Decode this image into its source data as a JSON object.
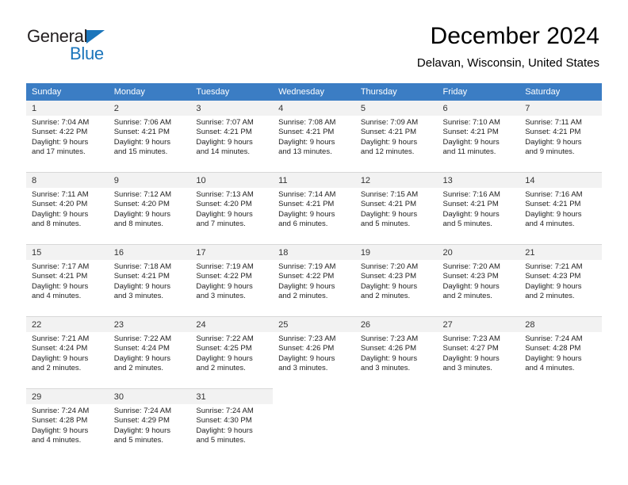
{
  "brand": {
    "word_one": "General",
    "word_two": "Blue",
    "triangle_icon": "triangle-icon",
    "accent_color": "#1b75bb"
  },
  "header": {
    "title": "December 2024",
    "subtitle": "Delavan, Wisconsin, United States"
  },
  "colors": {
    "header_blue": "#3b7dc4",
    "daynum_background": "#f2f2f2",
    "cell_background": "#ffffff",
    "grid_line": "#d8d8d8"
  },
  "weekday_headers": [
    "Sunday",
    "Monday",
    "Tuesday",
    "Wednesday",
    "Thursday",
    "Friday",
    "Saturday"
  ],
  "weeks": [
    {
      "days": [
        {
          "date": "1",
          "sunrise": "Sunrise: 7:04 AM",
          "sunset": "Sunset: 4:22 PM",
          "daylight_line1": "Daylight: 9 hours",
          "daylight_line2": "and 17 minutes."
        },
        {
          "date": "2",
          "sunrise": "Sunrise: 7:06 AM",
          "sunset": "Sunset: 4:21 PM",
          "daylight_line1": "Daylight: 9 hours",
          "daylight_line2": "and 15 minutes."
        },
        {
          "date": "3",
          "sunrise": "Sunrise: 7:07 AM",
          "sunset": "Sunset: 4:21 PM",
          "daylight_line1": "Daylight: 9 hours",
          "daylight_line2": "and 14 minutes."
        },
        {
          "date": "4",
          "sunrise": "Sunrise: 7:08 AM",
          "sunset": "Sunset: 4:21 PM",
          "daylight_line1": "Daylight: 9 hours",
          "daylight_line2": "and 13 minutes."
        },
        {
          "date": "5",
          "sunrise": "Sunrise: 7:09 AM",
          "sunset": "Sunset: 4:21 PM",
          "daylight_line1": "Daylight: 9 hours",
          "daylight_line2": "and 12 minutes."
        },
        {
          "date": "6",
          "sunrise": "Sunrise: 7:10 AM",
          "sunset": "Sunset: 4:21 PM",
          "daylight_line1": "Daylight: 9 hours",
          "daylight_line2": "and 11 minutes."
        },
        {
          "date": "7",
          "sunrise": "Sunrise: 7:11 AM",
          "sunset": "Sunset: 4:21 PM",
          "daylight_line1": "Daylight: 9 hours",
          "daylight_line2": "and 9 minutes."
        }
      ]
    },
    {
      "days": [
        {
          "date": "8",
          "sunrise": "Sunrise: 7:11 AM",
          "sunset": "Sunset: 4:20 PM",
          "daylight_line1": "Daylight: 9 hours",
          "daylight_line2": "and 8 minutes."
        },
        {
          "date": "9",
          "sunrise": "Sunrise: 7:12 AM",
          "sunset": "Sunset: 4:20 PM",
          "daylight_line1": "Daylight: 9 hours",
          "daylight_line2": "and 8 minutes."
        },
        {
          "date": "10",
          "sunrise": "Sunrise: 7:13 AM",
          "sunset": "Sunset: 4:20 PM",
          "daylight_line1": "Daylight: 9 hours",
          "daylight_line2": "and 7 minutes."
        },
        {
          "date": "11",
          "sunrise": "Sunrise: 7:14 AM",
          "sunset": "Sunset: 4:21 PM",
          "daylight_line1": "Daylight: 9 hours",
          "daylight_line2": "and 6 minutes."
        },
        {
          "date": "12",
          "sunrise": "Sunrise: 7:15 AM",
          "sunset": "Sunset: 4:21 PM",
          "daylight_line1": "Daylight: 9 hours",
          "daylight_line2": "and 5 minutes."
        },
        {
          "date": "13",
          "sunrise": "Sunrise: 7:16 AM",
          "sunset": "Sunset: 4:21 PM",
          "daylight_line1": "Daylight: 9 hours",
          "daylight_line2": "and 5 minutes."
        },
        {
          "date": "14",
          "sunrise": "Sunrise: 7:16 AM",
          "sunset": "Sunset: 4:21 PM",
          "daylight_line1": "Daylight: 9 hours",
          "daylight_line2": "and 4 minutes."
        }
      ]
    },
    {
      "days": [
        {
          "date": "15",
          "sunrise": "Sunrise: 7:17 AM",
          "sunset": "Sunset: 4:21 PM",
          "daylight_line1": "Daylight: 9 hours",
          "daylight_line2": "and 4 minutes."
        },
        {
          "date": "16",
          "sunrise": "Sunrise: 7:18 AM",
          "sunset": "Sunset: 4:21 PM",
          "daylight_line1": "Daylight: 9 hours",
          "daylight_line2": "and 3 minutes."
        },
        {
          "date": "17",
          "sunrise": "Sunrise: 7:19 AM",
          "sunset": "Sunset: 4:22 PM",
          "daylight_line1": "Daylight: 9 hours",
          "daylight_line2": "and 3 minutes."
        },
        {
          "date": "18",
          "sunrise": "Sunrise: 7:19 AM",
          "sunset": "Sunset: 4:22 PM",
          "daylight_line1": "Daylight: 9 hours",
          "daylight_line2": "and 2 minutes."
        },
        {
          "date": "19",
          "sunrise": "Sunrise: 7:20 AM",
          "sunset": "Sunset: 4:23 PM",
          "daylight_line1": "Daylight: 9 hours",
          "daylight_line2": "and 2 minutes."
        },
        {
          "date": "20",
          "sunrise": "Sunrise: 7:20 AM",
          "sunset": "Sunset: 4:23 PM",
          "daylight_line1": "Daylight: 9 hours",
          "daylight_line2": "and 2 minutes."
        },
        {
          "date": "21",
          "sunrise": "Sunrise: 7:21 AM",
          "sunset": "Sunset: 4:23 PM",
          "daylight_line1": "Daylight: 9 hours",
          "daylight_line2": "and 2 minutes."
        }
      ]
    },
    {
      "days": [
        {
          "date": "22",
          "sunrise": "Sunrise: 7:21 AM",
          "sunset": "Sunset: 4:24 PM",
          "daylight_line1": "Daylight: 9 hours",
          "daylight_line2": "and 2 minutes."
        },
        {
          "date": "23",
          "sunrise": "Sunrise: 7:22 AM",
          "sunset": "Sunset: 4:24 PM",
          "daylight_line1": "Daylight: 9 hours",
          "daylight_line2": "and 2 minutes."
        },
        {
          "date": "24",
          "sunrise": "Sunrise: 7:22 AM",
          "sunset": "Sunset: 4:25 PM",
          "daylight_line1": "Daylight: 9 hours",
          "daylight_line2": "and 2 minutes."
        },
        {
          "date": "25",
          "sunrise": "Sunrise: 7:23 AM",
          "sunset": "Sunset: 4:26 PM",
          "daylight_line1": "Daylight: 9 hours",
          "daylight_line2": "and 3 minutes."
        },
        {
          "date": "26",
          "sunrise": "Sunrise: 7:23 AM",
          "sunset": "Sunset: 4:26 PM",
          "daylight_line1": "Daylight: 9 hours",
          "daylight_line2": "and 3 minutes."
        },
        {
          "date": "27",
          "sunrise": "Sunrise: 7:23 AM",
          "sunset": "Sunset: 4:27 PM",
          "daylight_line1": "Daylight: 9 hours",
          "daylight_line2": "and 3 minutes."
        },
        {
          "date": "28",
          "sunrise": "Sunrise: 7:24 AM",
          "sunset": "Sunset: 4:28 PM",
          "daylight_line1": "Daylight: 9 hours",
          "daylight_line2": "and 4 minutes."
        }
      ]
    },
    {
      "days": [
        {
          "date": "29",
          "sunrise": "Sunrise: 7:24 AM",
          "sunset": "Sunset: 4:28 PM",
          "daylight_line1": "Daylight: 9 hours",
          "daylight_line2": "and 4 minutes."
        },
        {
          "date": "30",
          "sunrise": "Sunrise: 7:24 AM",
          "sunset": "Sunset: 4:29 PM",
          "daylight_line1": "Daylight: 9 hours",
          "daylight_line2": "and 5 minutes."
        },
        {
          "date": "31",
          "sunrise": "Sunrise: 7:24 AM",
          "sunset": "Sunset: 4:30 PM",
          "daylight_line1": "Daylight: 9 hours",
          "daylight_line2": "and 5 minutes."
        },
        {
          "date": "",
          "sunrise": "",
          "sunset": "",
          "daylight_line1": "",
          "daylight_line2": ""
        },
        {
          "date": "",
          "sunrise": "",
          "sunset": "",
          "daylight_line1": "",
          "daylight_line2": ""
        },
        {
          "date": "",
          "sunrise": "",
          "sunset": "",
          "daylight_line1": "",
          "daylight_line2": ""
        },
        {
          "date": "",
          "sunrise": "",
          "sunset": "",
          "daylight_line1": "",
          "daylight_line2": ""
        }
      ]
    }
  ]
}
